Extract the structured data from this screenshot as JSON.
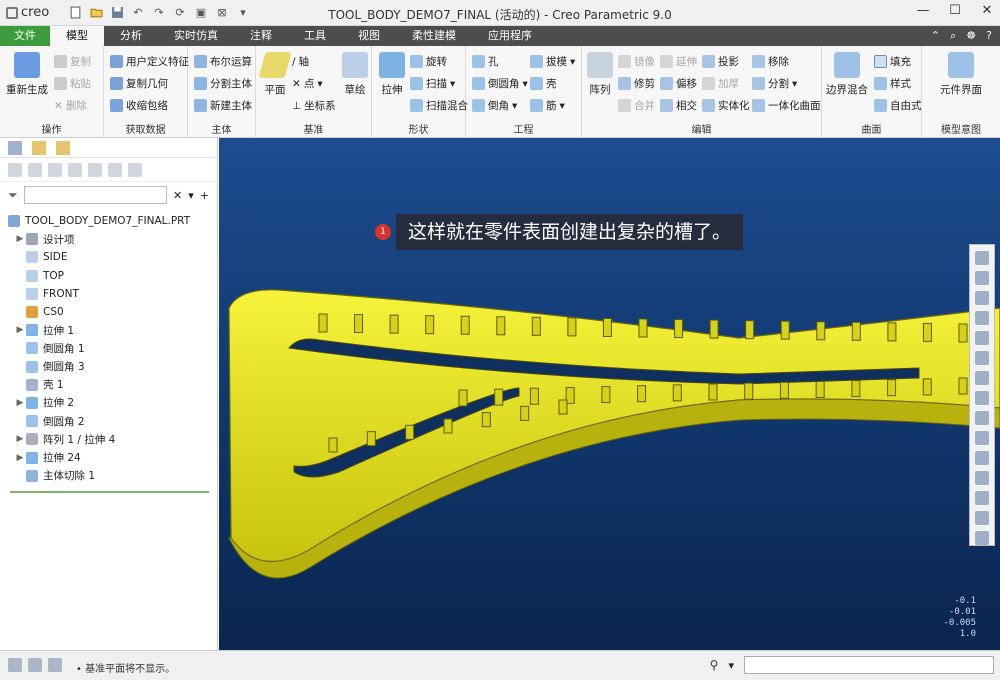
{
  "app": {
    "logo_text": "creo",
    "window_title": "TOOL_BODY_DEMO7_FINAL (活动的) - Creo Parametric 9.0"
  },
  "tabs": {
    "file": "文件",
    "items": [
      "模型",
      "分析",
      "实时仿真",
      "注释",
      "工具",
      "视图",
      "柔性建模",
      "应用程序"
    ]
  },
  "ribbon": {
    "operations": {
      "label": "操作",
      "regen": "重新生成",
      "copy": "复制",
      "paste": "粘贴",
      "delete": "删除"
    },
    "get_data": {
      "label": "获取数据",
      "udf": "用户定义特征",
      "copy_geom": "复制几何",
      "shrinkwrap": "收缩包络"
    },
    "body": {
      "label": "主体",
      "boolean": "布尔运算",
      "split_body": "分割主体",
      "new_body": "新建主体"
    },
    "datum": {
      "label": "基准",
      "plane": "平面",
      "axis": "轴",
      "point": "点",
      "csys": "坐标系",
      "sketch": "草绘"
    },
    "shapes": {
      "label": "形状",
      "extrude": "拉伸",
      "revolve": "旋转",
      "sweep": "扫描",
      "swept_blend": "扫描混合"
    },
    "engineering": {
      "label": "工程",
      "hole": "孔",
      "round": "倒圆角",
      "chamfer": "倒角",
      "draft": "拔模",
      "shell": "壳",
      "rib": "筋"
    },
    "editing": {
      "label": "编辑",
      "pattern": "阵列",
      "mirror": "镜像",
      "trim": "修剪",
      "merge": "合并",
      "extend": "延伸",
      "offset": "偏移",
      "intersect": "相交",
      "project": "投影",
      "thicken": "加厚",
      "solidify": "实体化",
      "remove": "移除",
      "split": "分割",
      "unify": "一体化曲面"
    },
    "surfaces": {
      "label": "曲面",
      "boundary_blend": "边界混合",
      "fill": "填充",
      "style": "样式",
      "freestyle": "自由式"
    },
    "model_intent": {
      "label": "模型意图",
      "component_interface": "元件界面"
    }
  },
  "tree": {
    "search_placeholder": "",
    "items": [
      {
        "label": "TOOL_BODY_DEMO7_FINAL.PRT",
        "icon": "part-icon",
        "expandable": false,
        "indent": 0
      },
      {
        "label": "设计项",
        "icon": "design-items-icon",
        "expandable": true,
        "indent": 1
      },
      {
        "label": "SIDE",
        "icon": "datum-plane-icon",
        "expandable": false,
        "indent": 1
      },
      {
        "label": "TOP",
        "icon": "datum-plane-icon",
        "expandable": false,
        "indent": 1
      },
      {
        "label": "FRONT",
        "icon": "datum-plane-icon",
        "expandable": false,
        "indent": 1
      },
      {
        "label": "CS0",
        "icon": "csys-icon",
        "expandable": false,
        "indent": 1
      },
      {
        "label": "拉伸 1",
        "icon": "extrude-icon",
        "expandable": true,
        "indent": 1
      },
      {
        "label": "倒圆角 1",
        "icon": "round-icon",
        "expandable": false,
        "indent": 1
      },
      {
        "label": "倒圆角 3",
        "icon": "round-icon",
        "expandable": false,
        "indent": 1
      },
      {
        "label": "壳 1",
        "icon": "shell-icon",
        "expandable": false,
        "indent": 1
      },
      {
        "label": "拉伸 2",
        "icon": "extrude-icon",
        "expandable": true,
        "indent": 1
      },
      {
        "label": "倒圆角 2",
        "icon": "round-icon",
        "expandable": false,
        "indent": 1
      },
      {
        "label": "阵列 1 / 拉伸 4",
        "icon": "pattern-icon",
        "expandable": true,
        "indent": 1
      },
      {
        "label": "拉伸 24",
        "icon": "extrude-icon",
        "expandable": true,
        "indent": 1
      },
      {
        "label": "主体切除 1",
        "icon": "body-cut-icon",
        "expandable": false,
        "indent": 1
      }
    ]
  },
  "viewport": {
    "callout_number": "1",
    "callout_text": "这样就在零件表面创建出复杂的槽了。",
    "coords": [
      "-0.1",
      "-0.01",
      "-0.005",
      "1.0"
    ]
  },
  "statusbar": {
    "message": "• 基准平面将不显示。"
  },
  "colors": {
    "accent_green": "#3c9b3c",
    "model_yellow": "#e6e21a",
    "viewport_top": "#1d4c8f",
    "viewport_bottom": "#0a2550"
  }
}
